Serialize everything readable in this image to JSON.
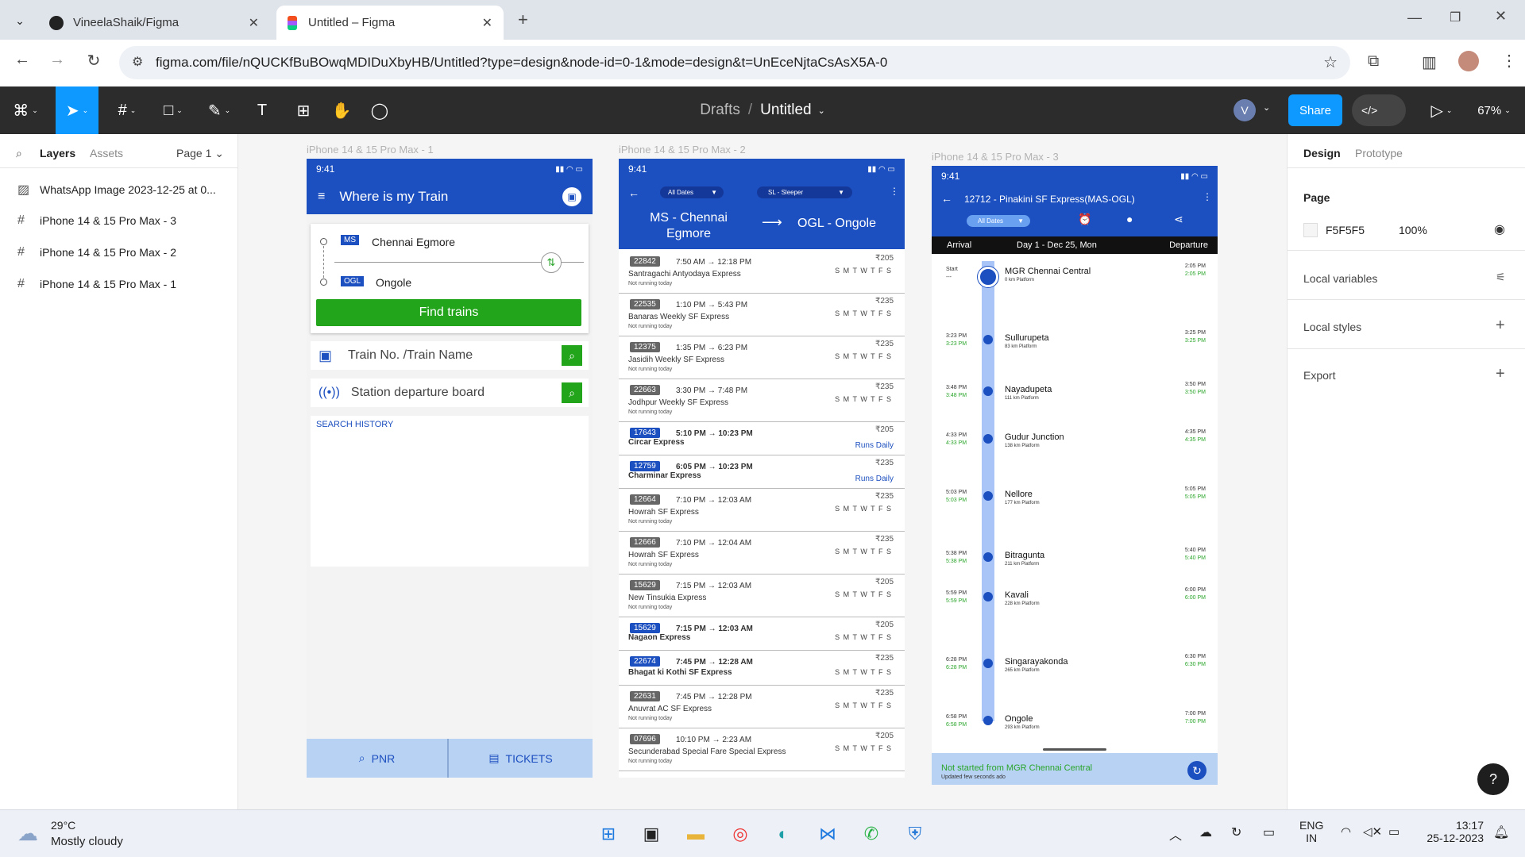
{
  "browser": {
    "tabs": [
      {
        "title": "VineelaShaik/Figma"
      },
      {
        "title": "Untitled – Figma"
      }
    ],
    "url": "figma.com/file/nQUCKfBuBOwqMDIDuXbyHB/Untitled?type=design&node-id=0-1&mode=design&t=UnEceNjtaCsAsX5A-0"
  },
  "figma": {
    "breadcrumb_drafts": "Drafts",
    "breadcrumb_sep": "/",
    "file_title": "Untitled",
    "avatar": "V",
    "share": "Share",
    "zoom": "67%",
    "left": {
      "tab_layers": "Layers",
      "tab_assets": "Assets",
      "page": "Page 1",
      "layers": [
        "WhatsApp Image 2023-12-25 at 0...",
        "iPhone 14 & 15 Pro Max - 3",
        "iPhone 14 & 15 Pro Max - 2",
        "iPhone 14 & 15 Pro Max - 1"
      ]
    },
    "right": {
      "tab_design": "Design",
      "tab_prototype": "Prototype",
      "page_label": "Page",
      "page_color": "F5F5F5",
      "page_opacity": "100%",
      "local_variables": "Local variables",
      "local_styles": "Local styles",
      "export": "Export"
    }
  },
  "frame1": {
    "label": "iPhone 14 & 15 Pro Max - 1",
    "time": "9:41",
    "title": "Where is my Train",
    "from_code": "MS",
    "from_name": "Chennai Egmore",
    "to_code": "OGL",
    "to_name": "Ongole",
    "find": "Find trains",
    "search1": "Train No. /Train Name",
    "search2": "Station departure board",
    "history": "SEARCH HISTORY",
    "pnr": "PNR",
    "tickets": "TICKETS"
  },
  "frame2": {
    "label": "iPhone 14 & 15 Pro Max - 2",
    "time": "9:41",
    "filter1": "All Dates",
    "filter2": "SL - Sleeper",
    "from": "MS - Chennai Egmore",
    "to": "OGL - Ongole",
    "trains": [
      {
        "no": "22842",
        "time": "7:50 AM → 12:18 PM",
        "name": "Santragachi Antyodaya Express",
        "fare": "₹205",
        "status": "Not running today",
        "blue": false
      },
      {
        "no": "22535",
        "time": "1:10 PM → 5:43 PM",
        "name": "Banaras Weekly SF Express",
        "fare": "₹235",
        "status": "Not running today",
        "blue": false
      },
      {
        "no": "12375",
        "time": "1:35 PM → 6:23 PM",
        "name": "Jasidih Weekly SF Express",
        "fare": "₹235",
        "status": "Not running today",
        "blue": false
      },
      {
        "no": "22663",
        "time": "3:30 PM → 7:48 PM",
        "name": "Jodhpur Weekly SF Express",
        "fare": "₹235",
        "status": "Not running today",
        "blue": false
      },
      {
        "no": "17643",
        "time": "5:10 PM → 10:23 PM",
        "name": "Circar Express",
        "fare": "₹205",
        "status": "Runs Daily",
        "blue": true
      },
      {
        "no": "12759",
        "time": "6:05 PM → 10:23 PM",
        "name": "Charminar Express",
        "fare": "₹235",
        "status": "Runs Daily",
        "blue": true
      },
      {
        "no": "12664",
        "time": "7:10 PM → 12:03 AM",
        "name": "Howrah SF Express",
        "fare": "₹235",
        "status": "Not running today",
        "blue": false
      },
      {
        "no": "12666",
        "time": "7:10 PM → 12:04 AM",
        "name": "Howrah SF Express",
        "fare": "₹235",
        "status": "Not running today",
        "blue": false
      },
      {
        "no": "15629",
        "time": "7:15 PM → 12:03 AM",
        "name": "New Tinsukia Express",
        "fare": "₹205",
        "status": "Not running today",
        "blue": false
      },
      {
        "no": "15629",
        "time": "7:15 PM → 12:03 AM",
        "name": "Nagaon Express",
        "fare": "₹205",
        "status": "",
        "blue": true
      },
      {
        "no": "22674",
        "time": "7:45 PM → 12:28 AM",
        "name": "Bhagat ki Kothi SF Express",
        "fare": "₹235",
        "status": "",
        "blue": true
      },
      {
        "no": "22631",
        "time": "7:45 PM → 12:28 PM",
        "name": "Anuvrat AC SF Express",
        "fare": "₹235",
        "status": "Not running today",
        "blue": false
      },
      {
        "no": "07696",
        "time": "10:10 PM → 2:23 AM",
        "name": "Secunderabad Special Fare Special Express",
        "fare": "₹205",
        "status": "Not running today",
        "blue": false
      }
    ],
    "days": "S M T W T F S"
  },
  "frame3": {
    "label": "iPhone 14 & 15 Pro Max - 3",
    "time": "9:41",
    "title": "12712 - Pinakini SF Express(MAS-OGL)",
    "filter": "All Dates",
    "arrival": "Arrival",
    "day": "Day 1 - Dec 25, Mon",
    "departure": "Departure",
    "stations": [
      {
        "arr": "Start",
        "arr2": "---",
        "name": "MGR Chennai Central",
        "km": "0 km Platform",
        "dep": "2:05 PM",
        "dep2": "2:05 PM"
      },
      {
        "arr": "3:23 PM",
        "arr2": "3:23 PM",
        "name": "Sullurupeta",
        "km": "83 km Platform",
        "dep": "3:25 PM",
        "dep2": "3:25 PM"
      },
      {
        "arr": "3:48 PM",
        "arr2": "3:48 PM",
        "name": "Nayadupeta",
        "km": "111 km Platform",
        "dep": "3:50 PM",
        "dep2": "3:50 PM"
      },
      {
        "arr": "4:33 PM",
        "arr2": "4:33 PM",
        "name": "Gudur Junction",
        "km": "138 km Platform",
        "dep": "4:35 PM",
        "dep2": "4:35 PM"
      },
      {
        "arr": "5:03 PM",
        "arr2": "5:03 PM",
        "name": "Nellore",
        "km": "177 km Platform",
        "dep": "5:05 PM",
        "dep2": "5:05 PM"
      },
      {
        "arr": "5:38 PM",
        "arr2": "5:38 PM",
        "name": "Bitragunta",
        "km": "211 km Platform",
        "dep": "5:40 PM",
        "dep2": "5:40 PM"
      },
      {
        "arr": "5:59 PM",
        "arr2": "5:59 PM",
        "name": "Kavali",
        "km": "228 km Platform",
        "dep": "6:00 PM",
        "dep2": "6:00 PM"
      },
      {
        "arr": "6:28 PM",
        "arr2": "6:28 PM",
        "name": "Singarayakonda",
        "km": "265 km Platform",
        "dep": "6:30 PM",
        "dep2": "6:30 PM"
      },
      {
        "arr": "6:58 PM",
        "arr2": "6:58 PM",
        "name": "Ongole",
        "km": "293 km Platform",
        "dep": "7:00 PM",
        "dep2": "7:00 PM"
      }
    ],
    "status": "Not started from MGR Chennai Central",
    "updated": "Updated few seconds ado"
  },
  "taskbar": {
    "temp": "29°C",
    "weather": "Mostly cloudy",
    "lang1": "ENG",
    "lang2": "IN",
    "time": "13:17",
    "date": "25-12-2023"
  },
  "colors": {
    "brand_blue": "#1c4fbf",
    "green": "#2aa52a",
    "figma_blue": "#0d99ff"
  }
}
